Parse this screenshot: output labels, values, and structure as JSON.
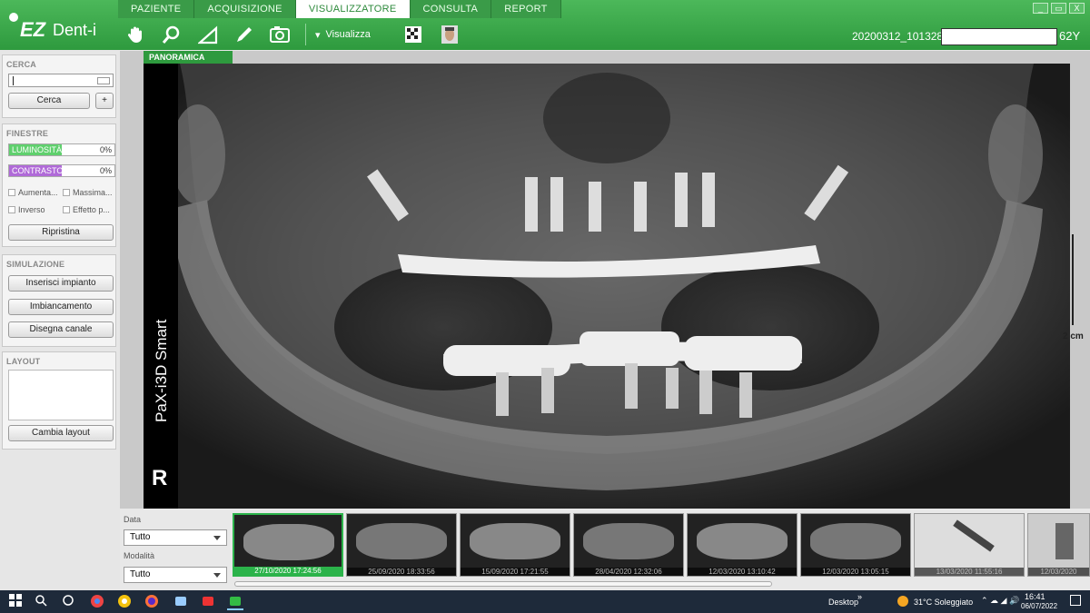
{
  "app": {
    "name_ez": "EZ",
    "name_dent": "Dent-i"
  },
  "tabs": [
    "PAZIENTE",
    "ACQUISIZIONE",
    "VISUALIZZATORE",
    "CONSULTA",
    "REPORT"
  ],
  "active_tab": "VISUALIZZATORE",
  "toolbar": {
    "visualizza_label": "Visualizza"
  },
  "patient": {
    "id": "20200312_101328",
    "age": "62Y"
  },
  "window_controls": [
    "_",
    "▭",
    "X"
  ],
  "cerca": {
    "title": "CERCA",
    "search_value": "",
    "search_button": "Cerca",
    "add_button": "+"
  },
  "finestre": {
    "title": "FINESTRE",
    "luminosita_label": "LUMINOSITÀ",
    "luminosita_value": "0%",
    "contrasto_label": "CONTRASTO",
    "contrasto_value": "0%",
    "checks": [
      "Aumenta...",
      "Massima...",
      "Inverso",
      "Effetto p..."
    ],
    "reset_button": "Ripristina",
    "luminosita_color": "#5fd06d",
    "contrasto_color": "#b06ad8"
  },
  "simulazione": {
    "title": "SIMULAZIONE",
    "buttons": [
      "Inserisci impianto",
      "Imbiancamento",
      "Disegna canale"
    ]
  },
  "layout": {
    "title": "LAYOUT",
    "button": "Cambia layout"
  },
  "view": {
    "tab": "PANORAMICA",
    "device": "PaX-i3D Smart",
    "side": "R",
    "scale": "2 cm"
  },
  "filters": {
    "data_label": "Data",
    "data_value": "Tutto",
    "modalita_label": "Modalità",
    "modalita_value": "Tutto"
  },
  "thumbnails": [
    "27/10/2020 17:24:56",
    "25/09/2020 18:33:56",
    "15/09/2020 17:21:55",
    "28/04/2020 12:32:06",
    "12/03/2020 13:10:42",
    "12/03/2020 13:05:15",
    "13/03/2020 11:55:16",
    "12/03/2020"
  ],
  "taskbar": {
    "desktop": "Desktop",
    "weather": "31°C  Soleggiato",
    "time": "16:41",
    "date": "06/07/2022"
  },
  "colors": {
    "accent": "#2e9a3e",
    "selected_thumb": "#2bb34a"
  }
}
